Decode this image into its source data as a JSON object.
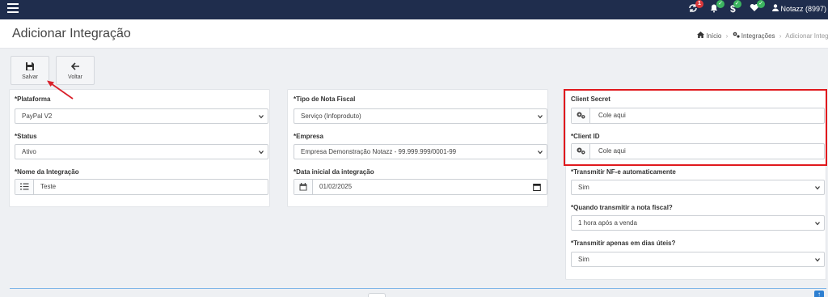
{
  "topbar": {
    "badges": {
      "sync": "1"
    },
    "user": "Notazz (8997)"
  },
  "header": {
    "title": "Adicionar Integração",
    "breadcrumb": [
      "Início",
      "Integrações",
      "Adicionar Integração"
    ]
  },
  "actions": {
    "save": "Salvar",
    "back": "Voltar"
  },
  "panel1": {
    "platform_label": "*Plataforma",
    "platform_value": "PayPal V2",
    "status_label": "*Status",
    "status_value": "Ativo",
    "name_label": "*Nome da Integração",
    "name_value": "Teste"
  },
  "panel2": {
    "invoice_type_label": "*Tipo de Nota Fiscal",
    "invoice_type_value": "Serviço (Infoproduto)",
    "company_label": "*Empresa",
    "company_value": "Empresa Demonstração Notazz - 99.999.999/0001-99",
    "start_date_label": "*Data inicial da integração",
    "start_date_value": "01/02/2025"
  },
  "panel3": {
    "client_secret_label": "Client Secret",
    "client_secret_placeholder": "Cole aqui",
    "client_id_label": "*Client ID",
    "client_id_placeholder": "Cole aqui",
    "auto_transmit_label": "*Transmitir NF-e automaticamente",
    "auto_transmit_value": "Sim",
    "when_label": "*Quando transmitir a nota fiscal?",
    "when_value": "1 hora após a venda",
    "business_days_label": "*Transmitir apenas em dias úteis?",
    "business_days_value": "Sim"
  },
  "colors": {
    "topbar": "#1f2d4d",
    "highlight": "#e0191d",
    "arrow": "#d9202a",
    "badge_red": "#d9383b",
    "badge_green": "#3cb460"
  }
}
